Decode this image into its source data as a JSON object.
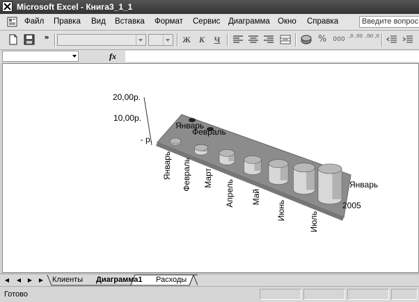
{
  "window": {
    "title": "Microsoft Excel - Книга3_1_1"
  },
  "menu": {
    "items": [
      "Файл",
      "Правка",
      "Вид",
      "Вставка",
      "Формат",
      "Сервис",
      "Диаграмма",
      "Окно",
      "Справка"
    ],
    "help_placeholder": "Введите вопрос"
  },
  "toolbar": {
    "chevron": "»",
    "bold": "Ж",
    "italic": "К",
    "underline": "Ч",
    "percent": "%",
    "thousands": "000",
    "inc_decimal": ",0 ,00",
    "dec_decimal": ",00 ,0"
  },
  "formula_bar": {
    "fx_label": "fx"
  },
  "chart_data": {
    "type": "bar",
    "style": "3d-cylinder",
    "categories": [
      "Январь",
      "Февраль",
      "Март",
      "Апрель",
      "Май",
      "Июнь",
      "Июль"
    ],
    "series": [
      {
        "name": "Январь",
        "values": [
          0.5,
          1.5,
          3,
          4,
          6,
          8,
          11
        ]
      },
      {
        "name": "Февраль",
        "values": [
          null,
          null,
          null,
          null,
          null,
          null,
          null
        ]
      }
    ],
    "depth_labels": [
      "Январь",
      "Февраль"
    ],
    "depth_label_front": [
      "Январь",
      "2005"
    ],
    "y_ticks": [
      "20,00р.",
      "10,00р.",
      "-   р."
    ],
    "ylim": [
      0,
      20
    ],
    "colors": {
      "wall": "#8c8c8c",
      "cylinder": "#d8d8d8",
      "cylinder_shade": "#9a9a9a"
    }
  },
  "sheets": {
    "tabs": [
      "Клиенты",
      "Диаграмма1",
      "Расходы"
    ],
    "active": "Диаграмма1"
  },
  "status": {
    "text": "Готово"
  }
}
